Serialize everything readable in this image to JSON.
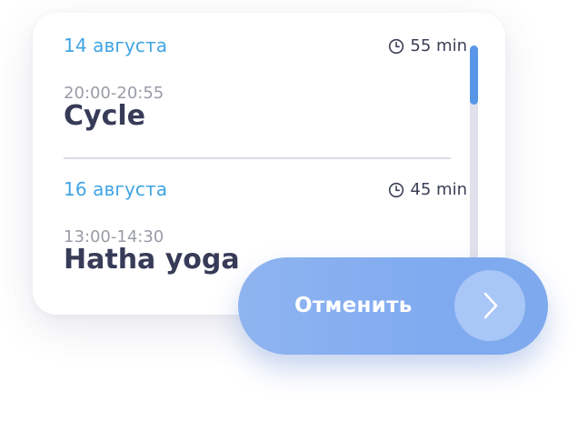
{
  "sessions": [
    {
      "date": "14 августа",
      "duration": "55 min",
      "time": "20:00-20:55",
      "title": "Cycle"
    },
    {
      "date": "16 августа",
      "duration": "45 min",
      "time": "13:00-14:30",
      "title": "Hatha yoga"
    }
  ],
  "action": {
    "label": "Отменить",
    "icon": "chevron-right-icon"
  },
  "icons": {
    "duration": "clock-icon"
  },
  "scroll": {
    "visible_fraction": 0.25,
    "position_fraction": 0
  },
  "colors": {
    "date": "#3fa4e2",
    "title": "#373b58",
    "time": "#9a9ca8",
    "scroll_thumb": "#5a96e8",
    "button": "#80abf0"
  }
}
